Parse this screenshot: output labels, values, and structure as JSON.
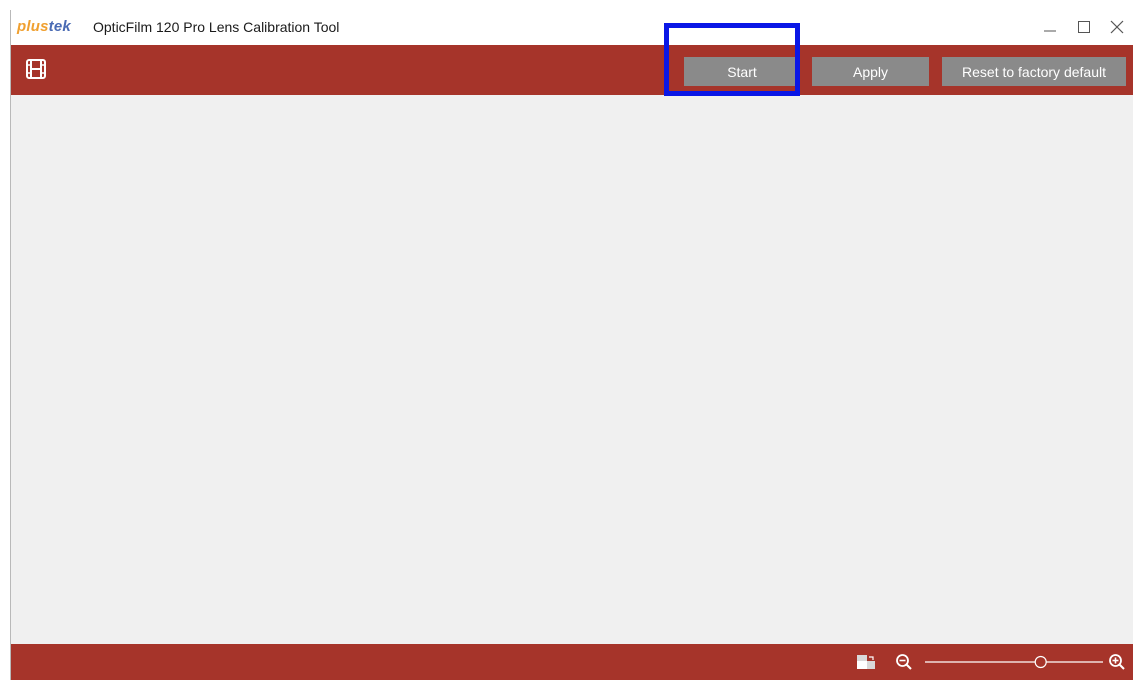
{
  "titlebar": {
    "logo_text_plus": "plus",
    "logo_text_tek": "tek",
    "app_title": "OpticFilm 120 Pro Lens Calibration Tool",
    "controls": [
      "minimize-icon",
      "maximize-icon",
      "close-icon"
    ]
  },
  "toolbar": {
    "icon": "film-icon",
    "start_label": "Start",
    "apply_label": "Apply",
    "reset_label": "Reset to factory default"
  },
  "statusbar": {
    "icons": [
      "fit-to-window-icon",
      "zoom-out-icon",
      "zoom-in-icon"
    ],
    "zoom_level_fraction": 0.65
  },
  "colors": {
    "accent": "#a6342a",
    "button_bg": "#8a8a8a",
    "highlight": "#0a17e6",
    "logo_orange": "#f0a030",
    "logo_blue": "#4a6bb4"
  }
}
